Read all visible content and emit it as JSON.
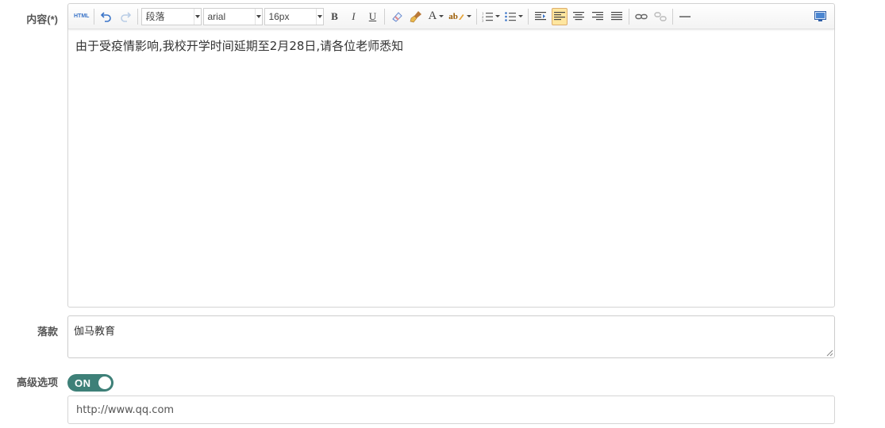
{
  "form": {
    "content_label": "内容(*)",
    "sign_label": "落款",
    "advanced_label": "高级选项"
  },
  "toolbar": {
    "html_label": "HTML",
    "paragraph_value": "段落",
    "font_family_value": "arial",
    "font_size_value": "16px",
    "bold_label": "B",
    "italic_label": "I",
    "underline_label": "U",
    "font_color_label": "A",
    "highlight_label": "ab"
  },
  "editor": {
    "content": "由于受疫情影响,我校开学时间延期至2月28日,请各位老师悉知"
  },
  "sign": {
    "value": "伽马教育"
  },
  "advanced": {
    "toggle_label": "ON",
    "toggle_on": true,
    "url_value": "http://www.qq.com"
  },
  "colors": {
    "toggle_bg": "#3e8078",
    "active_button_bg": "#ffe69f",
    "icon_blue": "#3a74c8"
  }
}
